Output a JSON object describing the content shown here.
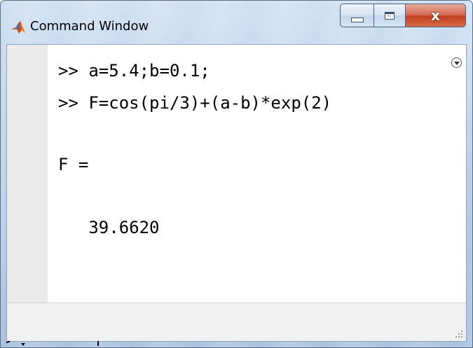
{
  "window": {
    "title": "Command Window",
    "icon": "matlab-logo-icon",
    "buttons": {
      "minimize": "minimize-icon",
      "maximize": "maximize-icon",
      "close": "close-icon",
      "close_color": "#c2401f"
    }
  },
  "console": {
    "lines": [
      ">> a=5.4;b=0.1;",
      ">> F=cos(pi/3)+(a-b)*exp(2)",
      "F =",
      "   39.6620"
    ],
    "prompt": ">> ",
    "fx_label": "fx",
    "menu_icon": "actions-menu-icon"
  },
  "colors": {
    "frame": "#b9cfe8",
    "console_bg": "#ffffff",
    "gutter_bg": "#ebebeb",
    "text": "#000000"
  }
}
